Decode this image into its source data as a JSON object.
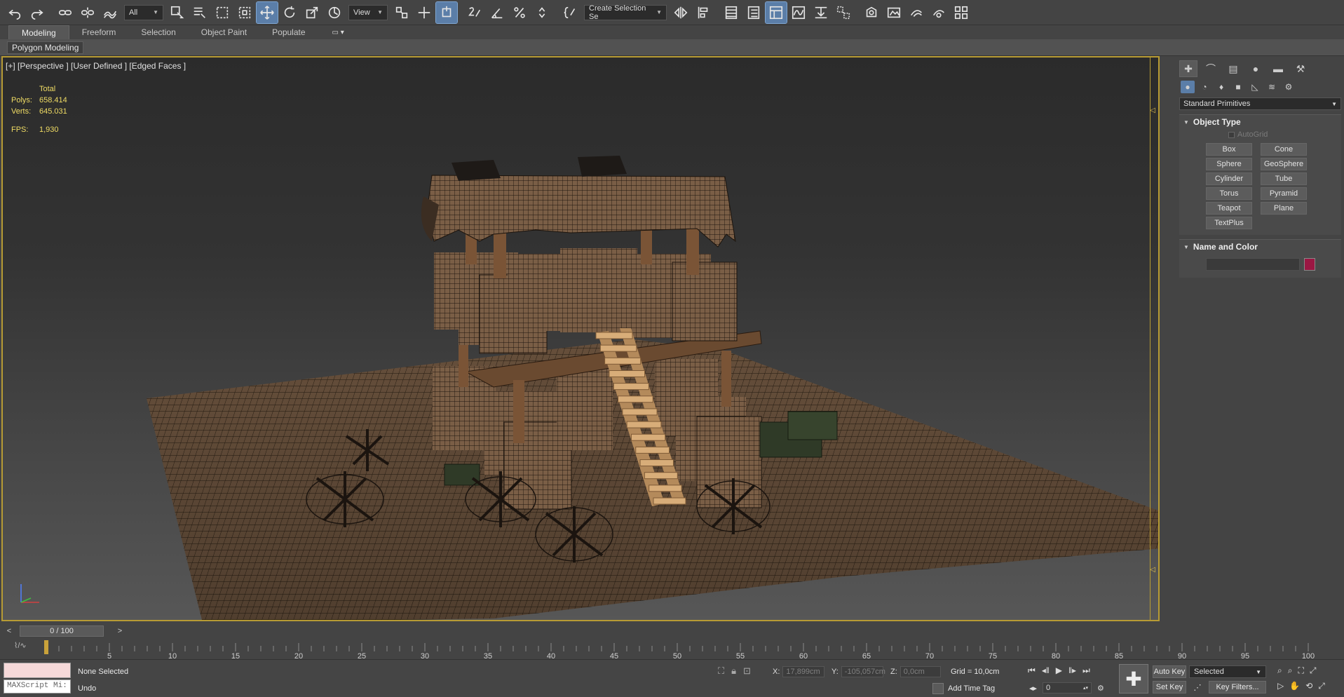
{
  "toolbar": {
    "filter_value": "All",
    "view_value": "View",
    "selection_set_value": "Create Selection Se",
    "icons": [
      "undo-icon",
      "redo-icon",
      "link-icon",
      "unlink-icon",
      "bind-space-warp-icon",
      "select-object-icon",
      "select-by-name-icon",
      "rect-selection-icon",
      "window-crossing-icon",
      "move-icon",
      "rotate-icon",
      "scale-icon",
      "place-icon",
      "use-pivot-icon",
      "manipulate-icon",
      "snaps-toggle-icon",
      "angle-snap-icon",
      "percent-snap-icon",
      "spinner-snap-icon",
      "edit-named-selection-icon",
      "mirror-icon",
      "align-icon",
      "scene-explorer-icon",
      "layer-explorer-icon",
      "toggle-ribbon-icon",
      "curve-editor-icon",
      "schematic-view-icon",
      "material-editor-icon",
      "render-setup-icon",
      "rendered-frame-icon",
      "render-production-icon",
      "render-iterative-icon",
      "render-cloud-icon",
      "render-gallery-icon"
    ]
  },
  "ribbon": {
    "tabs": [
      "Modeling",
      "Freeform",
      "Selection",
      "Object Paint",
      "Populate"
    ],
    "subpanel": "Polygon Modeling"
  },
  "viewport": {
    "label": "[+] [Perspective ] [User Defined ] [Edged Faces ]",
    "stats": {
      "header": "Total",
      "polys_label": "Polys:",
      "polys_value": "658.414",
      "verts_label": "Verts:",
      "verts_value": "645.031",
      "fps_label": "FPS:",
      "fps_value": "1,930"
    },
    "colors": {
      "border": "#b79b34",
      "stats": "#f0dc64",
      "mesh": "#6d543f",
      "wire": "#1e1712"
    }
  },
  "command_panel": {
    "dropdown": "Standard Primitives",
    "object_type": {
      "title": "Object Type",
      "autogrid": "AutoGrid",
      "buttons": [
        "Box",
        "Cone",
        "Sphere",
        "GeoSphere",
        "Cylinder",
        "Tube",
        "Torus",
        "Pyramid",
        "Teapot",
        "Plane",
        "TextPlus"
      ]
    },
    "name_color": {
      "title": "Name and Color",
      "swatch_color": "#9b1743"
    }
  },
  "timeline": {
    "current": "0 / 100",
    "prev": "<",
    "next": ">",
    "tick_labels": [
      "5",
      "10",
      "15",
      "20",
      "25",
      "30",
      "35",
      "40",
      "45",
      "50",
      "55",
      "60",
      "65",
      "70",
      "75",
      "80",
      "85",
      "90",
      "95",
      "100"
    ]
  },
  "status": {
    "maxscript": "MAXScript Mi:",
    "selection": "None Selected",
    "prompt": "Undo",
    "x_label": "X:",
    "x_value": "17,899cm",
    "y_label": "Y:",
    "y_value": "-105,057cm",
    "z_label": "Z:",
    "z_value": "0,0cm",
    "grid": "Grid = 10,0cm",
    "add_time_tag": "Add Time Tag",
    "auto_key": "Auto Key",
    "selected_dd": "Selected",
    "set_key": "Set Key",
    "key_filters": "Key Filters...",
    "frame": "0"
  }
}
